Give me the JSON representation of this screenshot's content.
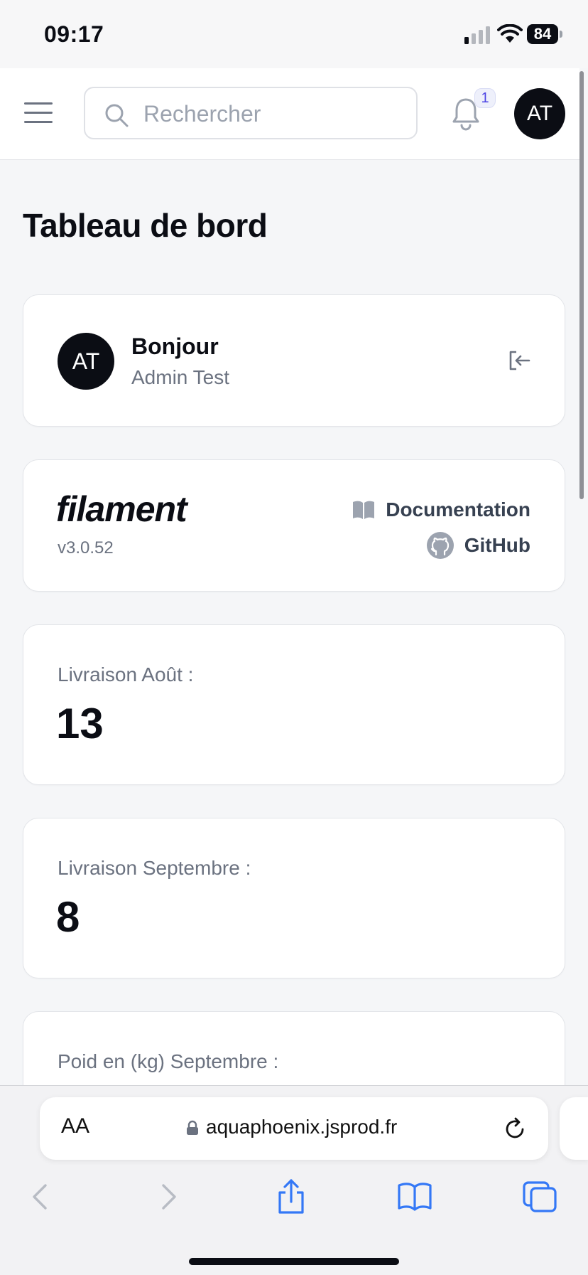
{
  "status_bar": {
    "time": "09:17",
    "battery": "84"
  },
  "topbar": {
    "search": {
      "placeholder": "Rechercher",
      "value": ""
    },
    "notifications_count": "1",
    "avatar_initials": "AT"
  },
  "page": {
    "title": "Tableau de bord"
  },
  "welcome": {
    "avatar_initials": "AT",
    "greeting": "Bonjour",
    "user_name": "Admin Test"
  },
  "filament": {
    "logo_text": "filament",
    "version": "v3.0.52",
    "documentation_label": "Documentation",
    "github_label": "GitHub"
  },
  "stats": [
    {
      "label": "Livraison Août :",
      "value": "13"
    },
    {
      "label": "Livraison Septembre :",
      "value": "8"
    },
    {
      "label": "Poid en (kg) Septembre :",
      "value": ""
    }
  ],
  "browser": {
    "text_size_label": "AA",
    "url": "aquaphoenix.jsprod.fr"
  },
  "colors": {
    "accent": "#3478f6",
    "dark": "#0b0d14",
    "muted": "#6b7280"
  }
}
